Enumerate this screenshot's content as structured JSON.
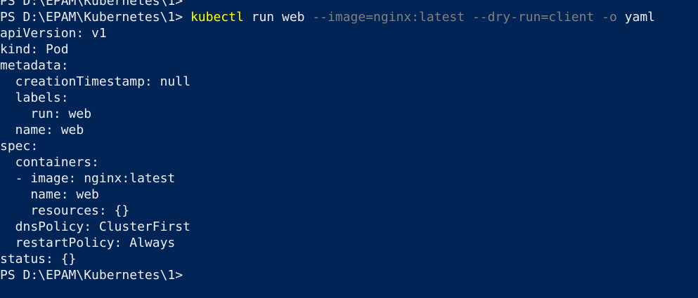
{
  "window": {
    "background": "#012456",
    "text_color": "#eeedf0",
    "command_color": "#ffff00",
    "parameter_color": "#808080"
  },
  "lines": [
    {
      "text": "PS D:\\EPAM\\Kubernetes\\1>"
    },
    {
      "prompt": "PS D:\\EPAM\\Kubernetes\\1> ",
      "command": "kubectl",
      "args1": " run web ",
      "flag1": "--image=nginx:latest --dry-run=client -o",
      "args2": " yaml"
    },
    {
      "text": "apiVersion: v1"
    },
    {
      "text": "kind: Pod"
    },
    {
      "text": "metadata:"
    },
    {
      "text": "  creationTimestamp: null"
    },
    {
      "text": "  labels:"
    },
    {
      "text": "    run: web"
    },
    {
      "text": "  name: web"
    },
    {
      "text": "spec:"
    },
    {
      "text": "  containers:"
    },
    {
      "text": "  - image: nginx:latest"
    },
    {
      "text": "    name: web"
    },
    {
      "text": "    resources: {}"
    },
    {
      "text": "  dnsPolicy: ClusterFirst"
    },
    {
      "text": "  restartPolicy: Always"
    },
    {
      "text": "status: {}"
    },
    {
      "text": "PS D:\\EPAM\\Kubernetes\\1>"
    }
  ]
}
